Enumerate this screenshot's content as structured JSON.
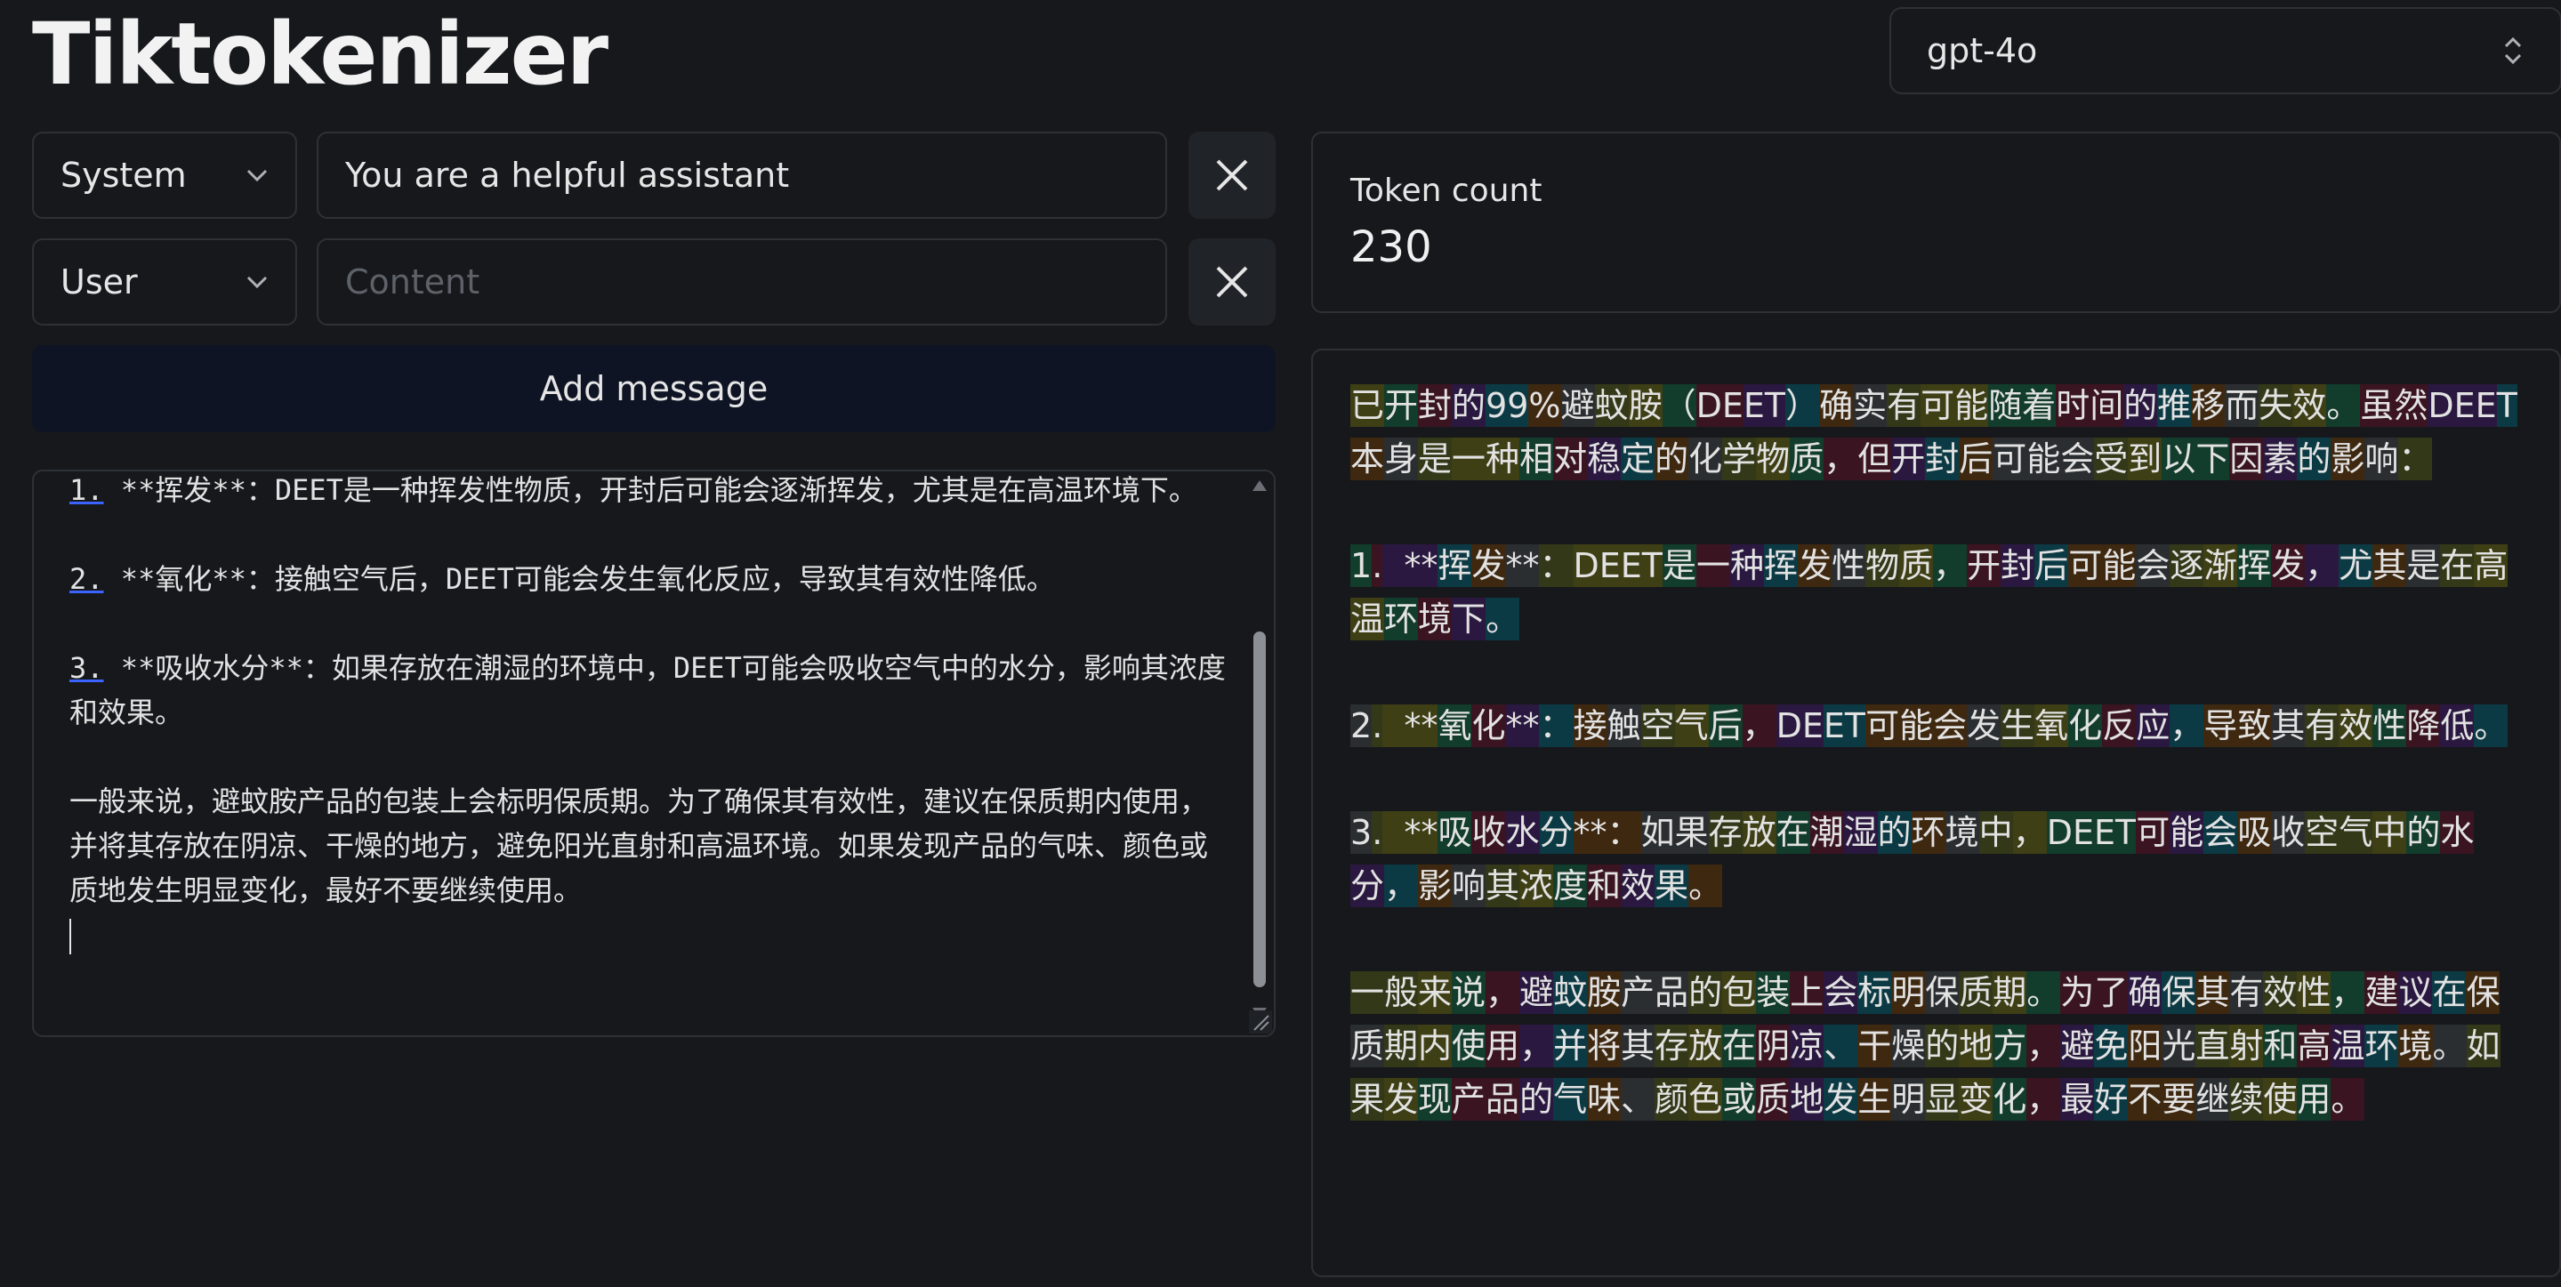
{
  "app": {
    "title": "Tiktokenizer"
  },
  "model_select": {
    "value": "gpt-4o"
  },
  "messages": [
    {
      "role": "System",
      "content": "You are a helpful assistant",
      "placeholder": "Content"
    },
    {
      "role": "User",
      "content": "",
      "placeholder": "Content"
    }
  ],
  "add_message_label": "Add message",
  "editor_text": {
    "p1_num": "1.",
    "p1": " **挥发**：DEET是一种挥发性物质，开封后可能会逐渐挥发，尤其是在高温环境下。",
    "p2_num": "2.",
    "p2": " **氧化**：接触空气后，DEET可能会发生氧化反应，导致其有效性降低。",
    "p3_num": "3.",
    "p3": " **吸收水分**：如果存放在潮湿的环境中，DEET可能会吸收空气中的水分，影响其浓度和效果。",
    "p4": "一般来说，避蚊胺产品的包装上会标明保质期。为了确保其有效性，建议在保质期内使用，并将其存放在阴凉、干燥的地方，避免阳光直射和高温环境。如果发现产品的气味、颜色或质地发生明显变化，最好不要继续使用。"
  },
  "token_count": {
    "label": "Token count",
    "value": "230"
  },
  "token_colors": [
    "#3f3f16",
    "#123c2c",
    "#3a1420",
    "#2a1840",
    "#0c3a44",
    "#3f2810",
    "#2b2e30",
    "#333818"
  ],
  "tokens": [
    "已",
    "开",
    "封",
    "的",
    "99",
    "%",
    "避",
    "蚊",
    "胺",
    "（",
    "DE",
    "ET",
    "）",
    "确",
    "实",
    "有",
    "可能",
    "随着",
    "时间",
    "的",
    "推",
    "移",
    "而",
    "失",
    "效",
    "。",
    "虽然",
    "DEE",
    "T",
    "本",
    "身",
    "是",
    "一种",
    "相",
    "对",
    "稳",
    "定",
    "的",
    "化",
    "学",
    "物",
    "质",
    "，但",
    "开",
    "封",
    "后",
    "可能会",
    "受",
    "到",
    "以下",
    "因",
    "素",
    "的",
    "影",
    "响",
    "：",
    "\n\n",
    "1",
    ".",
    "  **",
    "挥",
    "发",
    "**",
    "：",
    "DEET",
    "是",
    "一",
    "种",
    "挥",
    "发",
    "性",
    "物",
    "质",
    "，",
    "开",
    "封",
    "后",
    "可能",
    "会",
    "逐",
    "渐",
    "挥",
    "发",
    "，",
    "尤",
    "其",
    "是",
    "在",
    "高温",
    "环",
    "境",
    "下",
    "。",
    "\n\n",
    "2",
    ".",
    "  **",
    "氧",
    "化",
    "**",
    "：",
    "接",
    "触",
    "空",
    "气",
    "后",
    "，",
    "DE",
    "ET",
    "可能会",
    "发",
    "生",
    "氧",
    "化",
    "反",
    "应",
    "，",
    "导致",
    "其",
    "有",
    "效",
    "性",
    "降",
    "低",
    "。",
    "\n\n",
    "3",
    ".",
    "  **",
    "吸",
    "收",
    "水",
    "分",
    "**：",
    "如果",
    "存",
    "放",
    "在",
    "潮",
    "湿",
    "的",
    "环",
    "境",
    "中",
    "，",
    "DEET",
    "可",
    "能",
    "会",
    "吸",
    "收",
    "空气",
    "中",
    "的",
    "水",
    "分",
    "，",
    "影",
    "响",
    "其",
    "浓",
    "度",
    "和",
    "效",
    "果",
    "。",
    "\n\n",
    "一般",
    "来",
    "说",
    "，",
    "避",
    "蚊",
    "胺",
    "产品",
    "的",
    "包",
    "装",
    "上",
    "会",
    "标",
    "明",
    "保",
    "质",
    "期",
    "。",
    "为了",
    "确",
    "保",
    "其",
    "有",
    "效",
    "性",
    "，",
    "建",
    "议",
    "在",
    "保",
    "质",
    "期",
    "内",
    "使",
    "用",
    "，",
    "并",
    "将",
    "其",
    "存",
    "放",
    "在",
    "阴",
    "凉",
    "、",
    "干",
    "燥",
    "的",
    "地",
    "方",
    "，",
    "避",
    "免",
    "阳",
    "光",
    "直",
    "射",
    "和",
    "高",
    "温",
    "环",
    "境",
    "。",
    "如果",
    "发",
    "现",
    "产品",
    "的",
    "气",
    "味",
    "、",
    "颜",
    "色",
    "或",
    "质",
    "地",
    "发",
    "生",
    "明",
    "显",
    "变",
    "化",
    "，",
    "最",
    "好",
    "不要",
    "继",
    "续",
    "使",
    "用",
    "。"
  ]
}
